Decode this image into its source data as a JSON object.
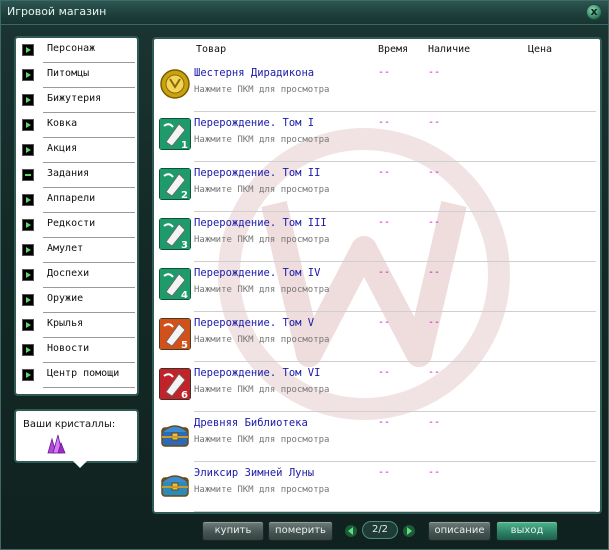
{
  "window": {
    "title": "Игровой магазин",
    "close_label": "x"
  },
  "sidebar": {
    "items": [
      {
        "label": "Персонаж",
        "marker": "arrow"
      },
      {
        "label": "Питомцы",
        "marker": "arrow"
      },
      {
        "label": "Бижутерия",
        "marker": "arrow"
      },
      {
        "label": "Ковка",
        "marker": "arrow"
      },
      {
        "label": "Акция",
        "marker": "arrow"
      },
      {
        "label": "Задания",
        "marker": "dash"
      },
      {
        "label": "Аппарели",
        "marker": "arrow"
      },
      {
        "label": "Редкости",
        "marker": "arrow"
      },
      {
        "label": "Амулет",
        "marker": "arrow"
      },
      {
        "label": "Доспехи",
        "marker": "arrow"
      },
      {
        "label": "Оружие",
        "marker": "arrow"
      },
      {
        "label": "Крылья",
        "marker": "arrow"
      },
      {
        "label": "Новости",
        "marker": "arrow"
      },
      {
        "label": "Центр помощи",
        "marker": "arrow"
      }
    ]
  },
  "crystals": {
    "label": "Ваши кристаллы:",
    "icon": "crystal-icon"
  },
  "table": {
    "headers": {
      "item": "Товар",
      "time": "Время",
      "stock": "Наличие",
      "price": "Цена"
    },
    "rows": [
      {
        "name": "Шестерня Дирадикона",
        "hint": "Нажмите ПКМ для просмотра",
        "time": "--",
        "stock": "--",
        "icon": "gear-coin-icon",
        "icon_color": "#c9a210"
      },
      {
        "name": "Перерождение. Том I",
        "hint": "Нажмите ПКМ для просмотра",
        "time": "--",
        "stock": "--",
        "icon": "rebirth-scroll-icon",
        "icon_color": "#1f9a6a",
        "tome": "1"
      },
      {
        "name": "Перерождение. Том II",
        "hint": "Нажмите ПКМ для просмотра",
        "time": "--",
        "stock": "--",
        "icon": "rebirth-scroll-icon",
        "icon_color": "#1f9a6a",
        "tome": "2"
      },
      {
        "name": "Перерождение. Том III",
        "hint": "Нажмите ПКМ для просмотра",
        "time": "--",
        "stock": "--",
        "icon": "rebirth-scroll-icon",
        "icon_color": "#1f9a6a",
        "tome": "3"
      },
      {
        "name": "Перерождение. Том IV",
        "hint": "Нажмите ПКМ для просмотра",
        "time": "--",
        "stock": "--",
        "icon": "rebirth-scroll-icon",
        "icon_color": "#1f9a6a",
        "tome": "4"
      },
      {
        "name": "Перерождение. Том V",
        "hint": "Нажмите ПКМ для просмотра",
        "time": "--",
        "stock": "--",
        "icon": "rebirth-scroll-icon",
        "icon_color": "#d2501a",
        "tome": "5"
      },
      {
        "name": "Перерождение. Том VI",
        "hint": "Нажмите ПКМ для просмотра",
        "time": "--",
        "stock": "--",
        "icon": "rebirth-scroll-icon",
        "icon_color": "#c0242a",
        "tome": "6"
      },
      {
        "name": "Древняя Библиотека",
        "hint": "Нажмите ПКМ для просмотра",
        "time": "--",
        "stock": "--",
        "icon": "treasure-chest-icon",
        "icon_color": "#2a6ab8"
      },
      {
        "name": "Эликсир Зимней Луны",
        "hint": "Нажмите ПКМ для просмотра",
        "time": "--",
        "stock": "--",
        "icon": "treasure-chest-icon",
        "icon_color": "#2a8ab8"
      }
    ]
  },
  "footer": {
    "buy_label": "купить",
    "try_label": "померить",
    "page": "2/2",
    "description_label": "описание",
    "exit_label": "выход"
  }
}
